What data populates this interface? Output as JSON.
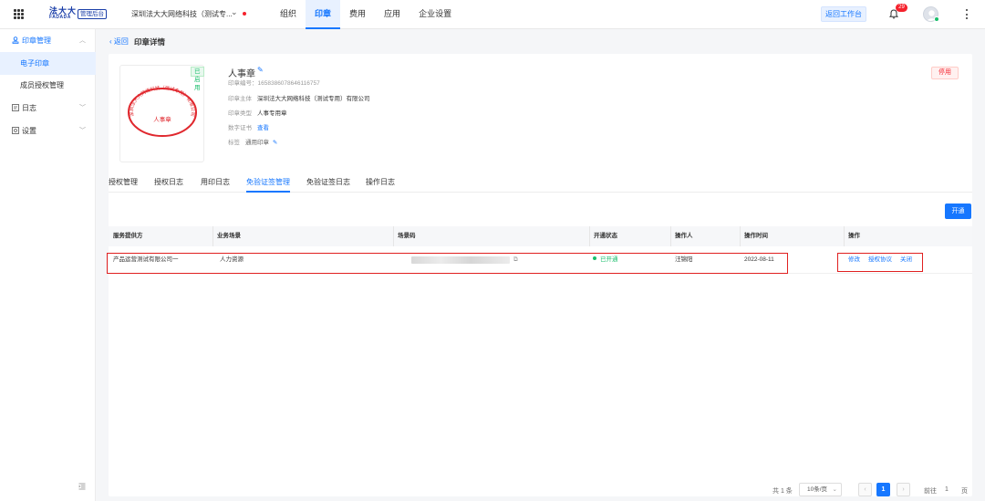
{
  "topbar": {
    "logo_cn": "法大大",
    "logo_en": "FADADA",
    "admin_badge": "管理后台",
    "org_name": "深圳法大大网络科技（测试专...",
    "nav": [
      {
        "label": "组织",
        "active": false
      },
      {
        "label": "印章",
        "active": true
      },
      {
        "label": "费用",
        "active": false
      },
      {
        "label": "应用",
        "active": false
      },
      {
        "label": "企业设置",
        "active": false
      }
    ],
    "return_workspace": "返回工作台",
    "notification_count": "29"
  },
  "sidebar": {
    "seal_management": "印章管理",
    "electronic_seal": "电子印章",
    "member_authorization": "成员授权管理",
    "log": "日志",
    "settings": "设置"
  },
  "page": {
    "back": "返回",
    "title": "印章详情"
  },
  "seal": {
    "status": "已启用",
    "name": "人事章",
    "code_label": "印章编号：",
    "code": "1658386078646116757",
    "owner_label": "印章主体",
    "owner": "深圳法大大网络科技（测试专用）有限公司",
    "type_label": "印章类型",
    "type": "人事专用章",
    "cert_label": "数字证书",
    "cert_action": "查看",
    "tag_label": "标签",
    "tag": "通用印章",
    "stamp_text_arc": "深圳法大大网络科技（测试专用）有限公司",
    "stamp_text_center": "人事章",
    "stop_button": "停用"
  },
  "tabs": [
    {
      "label": "授权管理",
      "active": false
    },
    {
      "label": "授权日志",
      "active": false
    },
    {
      "label": "用印日志",
      "active": false
    },
    {
      "label": "免验证签管理",
      "active": true
    },
    {
      "label": "免验证签日志",
      "active": false
    },
    {
      "label": "操作日志",
      "active": false
    }
  ],
  "table": {
    "open_button": "开通",
    "columns": [
      "服务提供方",
      "业务场景",
      "场景码",
      "开通状态",
      "操作人",
      "操作时间",
      "操作"
    ],
    "rows": [
      {
        "provider": "产品运营测试有限公司一",
        "scene": "人力资源",
        "status": "已开通",
        "operator": "汪锦阳",
        "time": "2022-08-11",
        "actions": [
          "修改",
          "授权协议",
          "关闭"
        ]
      }
    ]
  },
  "pagination": {
    "total": "共 1 条",
    "page_size": "10条/页",
    "current_page": "1",
    "goto_label": "前往",
    "goto_value": "1",
    "page_unit": "页"
  },
  "colors": {
    "primary": "#1677ff",
    "success": "#19be6b",
    "danger": "#f5222d",
    "stamp_red": "#e0282e"
  }
}
